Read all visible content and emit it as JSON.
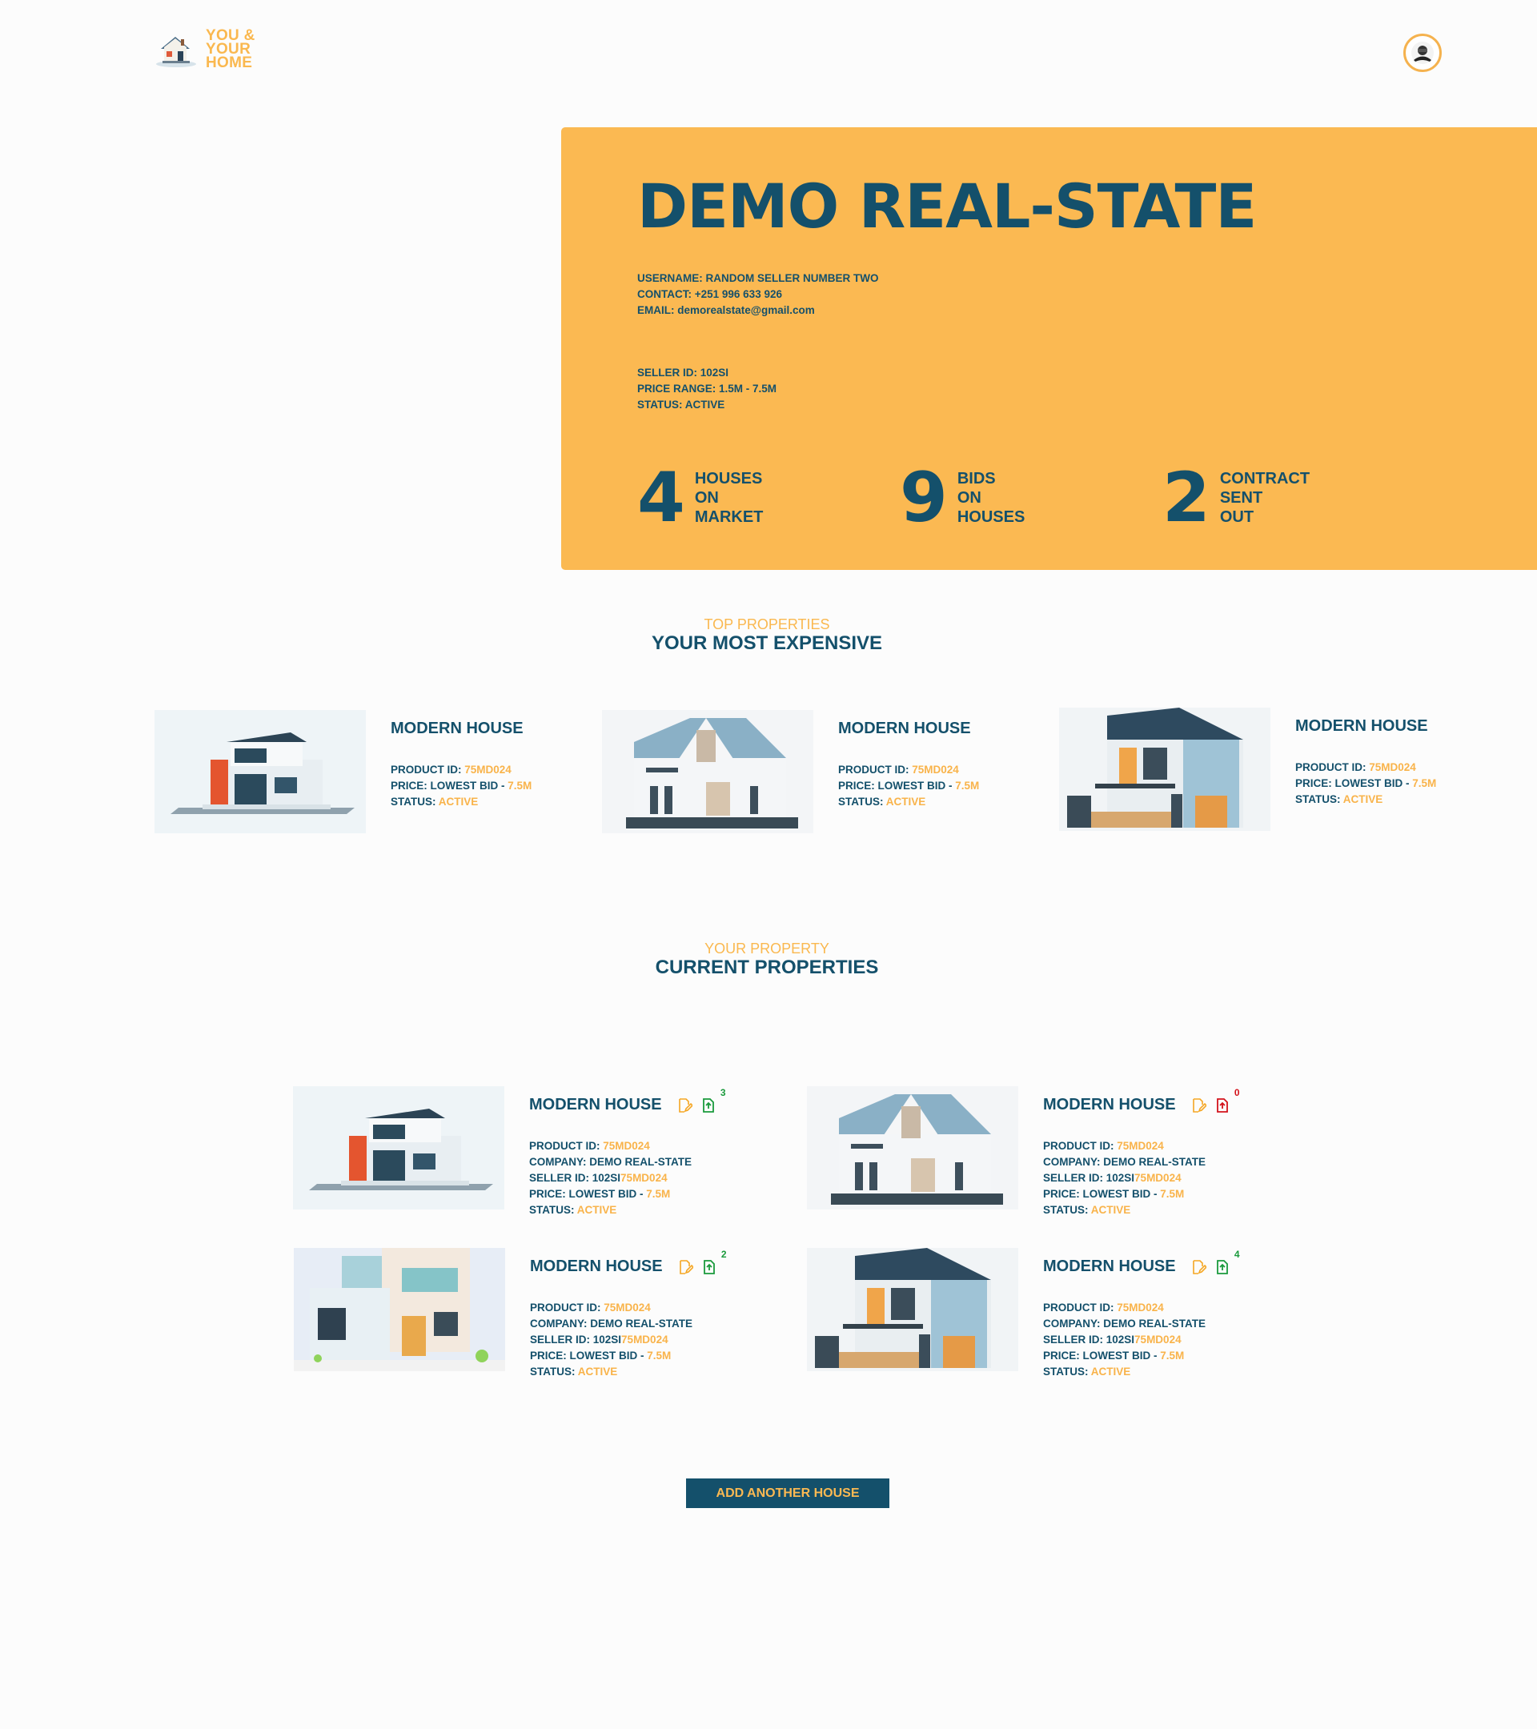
{
  "header": {
    "logo_lines": [
      "YOU &",
      "YOUR",
      "HOME"
    ]
  },
  "hero": {
    "title": "DEMO REAL-STATE",
    "username": "USERNAME: RANDOM SELLER NUMBER TWO",
    "contact": "CONTACT: +251 996 633 926",
    "email": "EMAIL: demorealstate@gmail.com",
    "seller_id": "SELLER ID: 102SI",
    "price_range": "PRICE RANGE: 1.5M - 7.5M",
    "status": "STATUS: ACTIVE",
    "stats": [
      {
        "number": "4",
        "lines": [
          "HOUSES",
          "ON",
          "MARKET"
        ]
      },
      {
        "number": "9",
        "lines": [
          "BIDS",
          "ON",
          "HOUSES"
        ]
      },
      {
        "number": "2",
        "lines": [
          "CONTRACT",
          "SENT",
          "OUT"
        ]
      }
    ]
  },
  "top_section": {
    "subtitle": "TOP PROPERTIES",
    "title": "YOUR MOST EXPENSIVE",
    "cards": [
      {
        "title": "MODERN HOUSE",
        "product_label": "PRODUCT ID: ",
        "product_id": "75MD024",
        "price_label": "PRICE: LOWEST BID - ",
        "price": "7.5M",
        "status_label": "STATUS: ",
        "status": "ACTIVE"
      },
      {
        "title": "MODERN HOUSE",
        "product_label": "PRODUCT ID: ",
        "product_id": "75MD024",
        "price_label": "PRICE: LOWEST BID - ",
        "price": "7.5M",
        "status_label": "STATUS: ",
        "status": "ACTIVE"
      },
      {
        "title": "MODERN HOUSE",
        "product_label": "PRODUCT ID: ",
        "product_id": "75MD024",
        "price_label": "PRICE: LOWEST BID - ",
        "price": "7.5M",
        "status_label": "STATUS: ",
        "status": "ACTIVE"
      }
    ]
  },
  "current_section": {
    "subtitle": "YOUR PROPERTY",
    "title": "CURRENT PROPERTIES",
    "cards": [
      {
        "title": "MODERN HOUSE",
        "contract_count": "3",
        "contract_color": "#1a9a3c",
        "product_label": "PRODUCT ID: ",
        "product_id": "75MD024",
        "company": "COMPANY: DEMO REAL-STATE",
        "seller_label": "SELLER ID: 102SI",
        "seller_suffix": "75MD024",
        "price_label": "PRICE: LOWEST BID - ",
        "price": "7.5M",
        "status_label": "STATUS: ",
        "status": "ACTIVE"
      },
      {
        "title": "MODERN HOUSE",
        "contract_count": "0",
        "contract_color": "#d3121b",
        "product_label": "PRODUCT ID: ",
        "product_id": "75MD024",
        "company": "COMPANY: DEMO REAL-STATE",
        "seller_label": "SELLER ID: 102SI",
        "seller_suffix": "75MD024",
        "price_label": "PRICE: LOWEST BID - ",
        "price": "7.5M",
        "status_label": "STATUS: ",
        "status": "ACTIVE"
      },
      {
        "title": "MODERN HOUSE",
        "contract_count": "2",
        "contract_color": "#1a9a3c",
        "product_label": "PRODUCT ID: ",
        "product_id": "75MD024",
        "company": "COMPANY: DEMO REAL-STATE",
        "seller_label": "SELLER ID: 102SI",
        "seller_suffix": "75MD024",
        "price_label": "PRICE: LOWEST BID - ",
        "price": "7.5M",
        "status_label": "STATUS: ",
        "status": "ACTIVE"
      },
      {
        "title": "MODERN HOUSE",
        "contract_count": "4",
        "contract_color": "#1a9a3c",
        "product_label": "PRODUCT ID: ",
        "product_id": "75MD024",
        "company": "COMPANY: DEMO REAL-STATE",
        "seller_label": "SELLER ID: 102SI",
        "seller_suffix": "75MD024",
        "price_label": "PRICE: LOWEST BID - ",
        "price": "7.5M",
        "status_label": "STATUS: ",
        "status": "ACTIVE"
      }
    ]
  },
  "add_button_label": "ADD ANOTHER HOUSE",
  "colors": {
    "accent_orange": "#fbb952",
    "primary_blue": "#14506b",
    "edit_icon": "#f5a623"
  }
}
